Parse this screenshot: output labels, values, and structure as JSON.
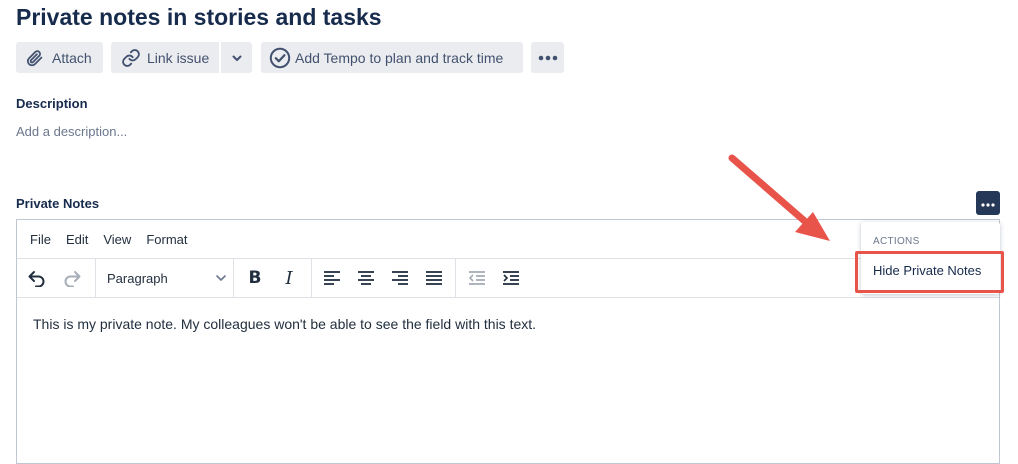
{
  "page": {
    "title": "Private notes in stories and tasks"
  },
  "toolbar": {
    "attach_label": "Attach",
    "link_issue_label": "Link issue",
    "tempo_label": "Add Tempo to plan and track time"
  },
  "description": {
    "label": "Description",
    "placeholder": "Add a description..."
  },
  "private_notes": {
    "label": "Private Notes",
    "menu": [
      "File",
      "Edit",
      "View",
      "Format"
    ],
    "block_format": "Paragraph",
    "bold_glyph": "B",
    "italic_glyph": "I",
    "content": "This is my private note. My colleagues won't be able to see the field with this text."
  },
  "actions_popup": {
    "heading": "ACTIONS",
    "item": "Hide Private Notes"
  },
  "colors": {
    "accent": "#253858",
    "annotation": "#e8544a",
    "text": "#172b4d"
  }
}
